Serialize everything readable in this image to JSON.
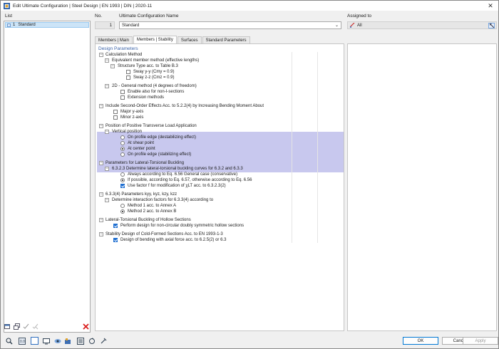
{
  "window": {
    "title": "Edit Ultimate Configuration | Steel Design | EN 1993 | DIN | 2020-11"
  },
  "list": {
    "header": "List",
    "items": [
      {
        "number": "1",
        "label": "Standard"
      }
    ]
  },
  "header": {
    "no_label": "No.",
    "no_value": "1",
    "name_label": "Ultimate Configuration Name",
    "name_value": "Standard",
    "assigned_label": "Assigned to",
    "assigned_value": "All"
  },
  "tabs": [
    {
      "label": "Members | Main",
      "active": false
    },
    {
      "label": "Members | Stability",
      "active": true
    },
    {
      "label": "Surfaces",
      "active": false
    },
    {
      "label": "Standard Parameters",
      "active": false
    }
  ],
  "design_parameters": {
    "section_title": "Design Parameters",
    "calc_method": "Calculation Method",
    "equiv_member": "Equivalent member method (effective lengths)",
    "structure_type": "Structure Type acc. to Table B.3",
    "sway_yy": "Sway y-y (Cmy = 0.9)",
    "sway_zz": "Sway z-z (Cmz = 0.9)",
    "general_2d": "2D - General method (4 degrees of freedom)",
    "enable_non_i": "Enable also for non-I-sections",
    "extension_methods": "Extension methods",
    "second_order": "Include Second-Order Effects Acc. to 5.2.2(4) by Increasing Bending Moment About",
    "major_axis": "Major y-axis",
    "minor_axis": "Minor z-axis",
    "position_title": "Position of Positive Transverse Load Application",
    "vertical_position": "Vertical position",
    "pos_destab": "On profile edge (destabilizing effect)",
    "pos_shear": "At shear point",
    "pos_center": "At center point",
    "pos_stab": "On profile edge (stabilizing effect)",
    "ltb_params": "Parameters for Lateral-Torsional Buckling",
    "ltb_6323": "6.3.2.3 Determine lateral-torsional buckling curves for 6.3.2 and 6.3.3",
    "ltb_always": "Always according to Eq. 6.56 General case (conservative)",
    "ltb_possible": "If possible, according to Eq. 6.57, otherwise according to Eq. 6.56",
    "ltb_factor_f": "Use factor f for modification of χLT acc. to 6.3.2.3(2)",
    "params_633": "6.3.3(4) Parameters kyy, kyz, kzy, kzz",
    "interaction": "Determine interaction factors for 6.3.3(4) according to",
    "method_1": "Method 1 acc. to Annex A",
    "method_2": "Method 2 acc. to Annex B",
    "ltb_hollow": "Lateral-Torsional Buckling of Hollow Sections",
    "hollow_design": "Perform design for non-circular doubly symmetric hollow sections",
    "cold_formed": "Stability Design of Cold-Formed Sections Acc. to EN 1993-1-3",
    "cold_bending": "Design of bending with axial force acc. to 6.2.5(2) or 6.3"
  },
  "buttons": {
    "ok": "OK",
    "cancel": "Cancel",
    "apply": "Apply"
  },
  "colors": {
    "accent": "#1f6fd1",
    "highlight": "#c8c8ee",
    "section_title": "#3b63a8",
    "delete": "#d9201f"
  }
}
